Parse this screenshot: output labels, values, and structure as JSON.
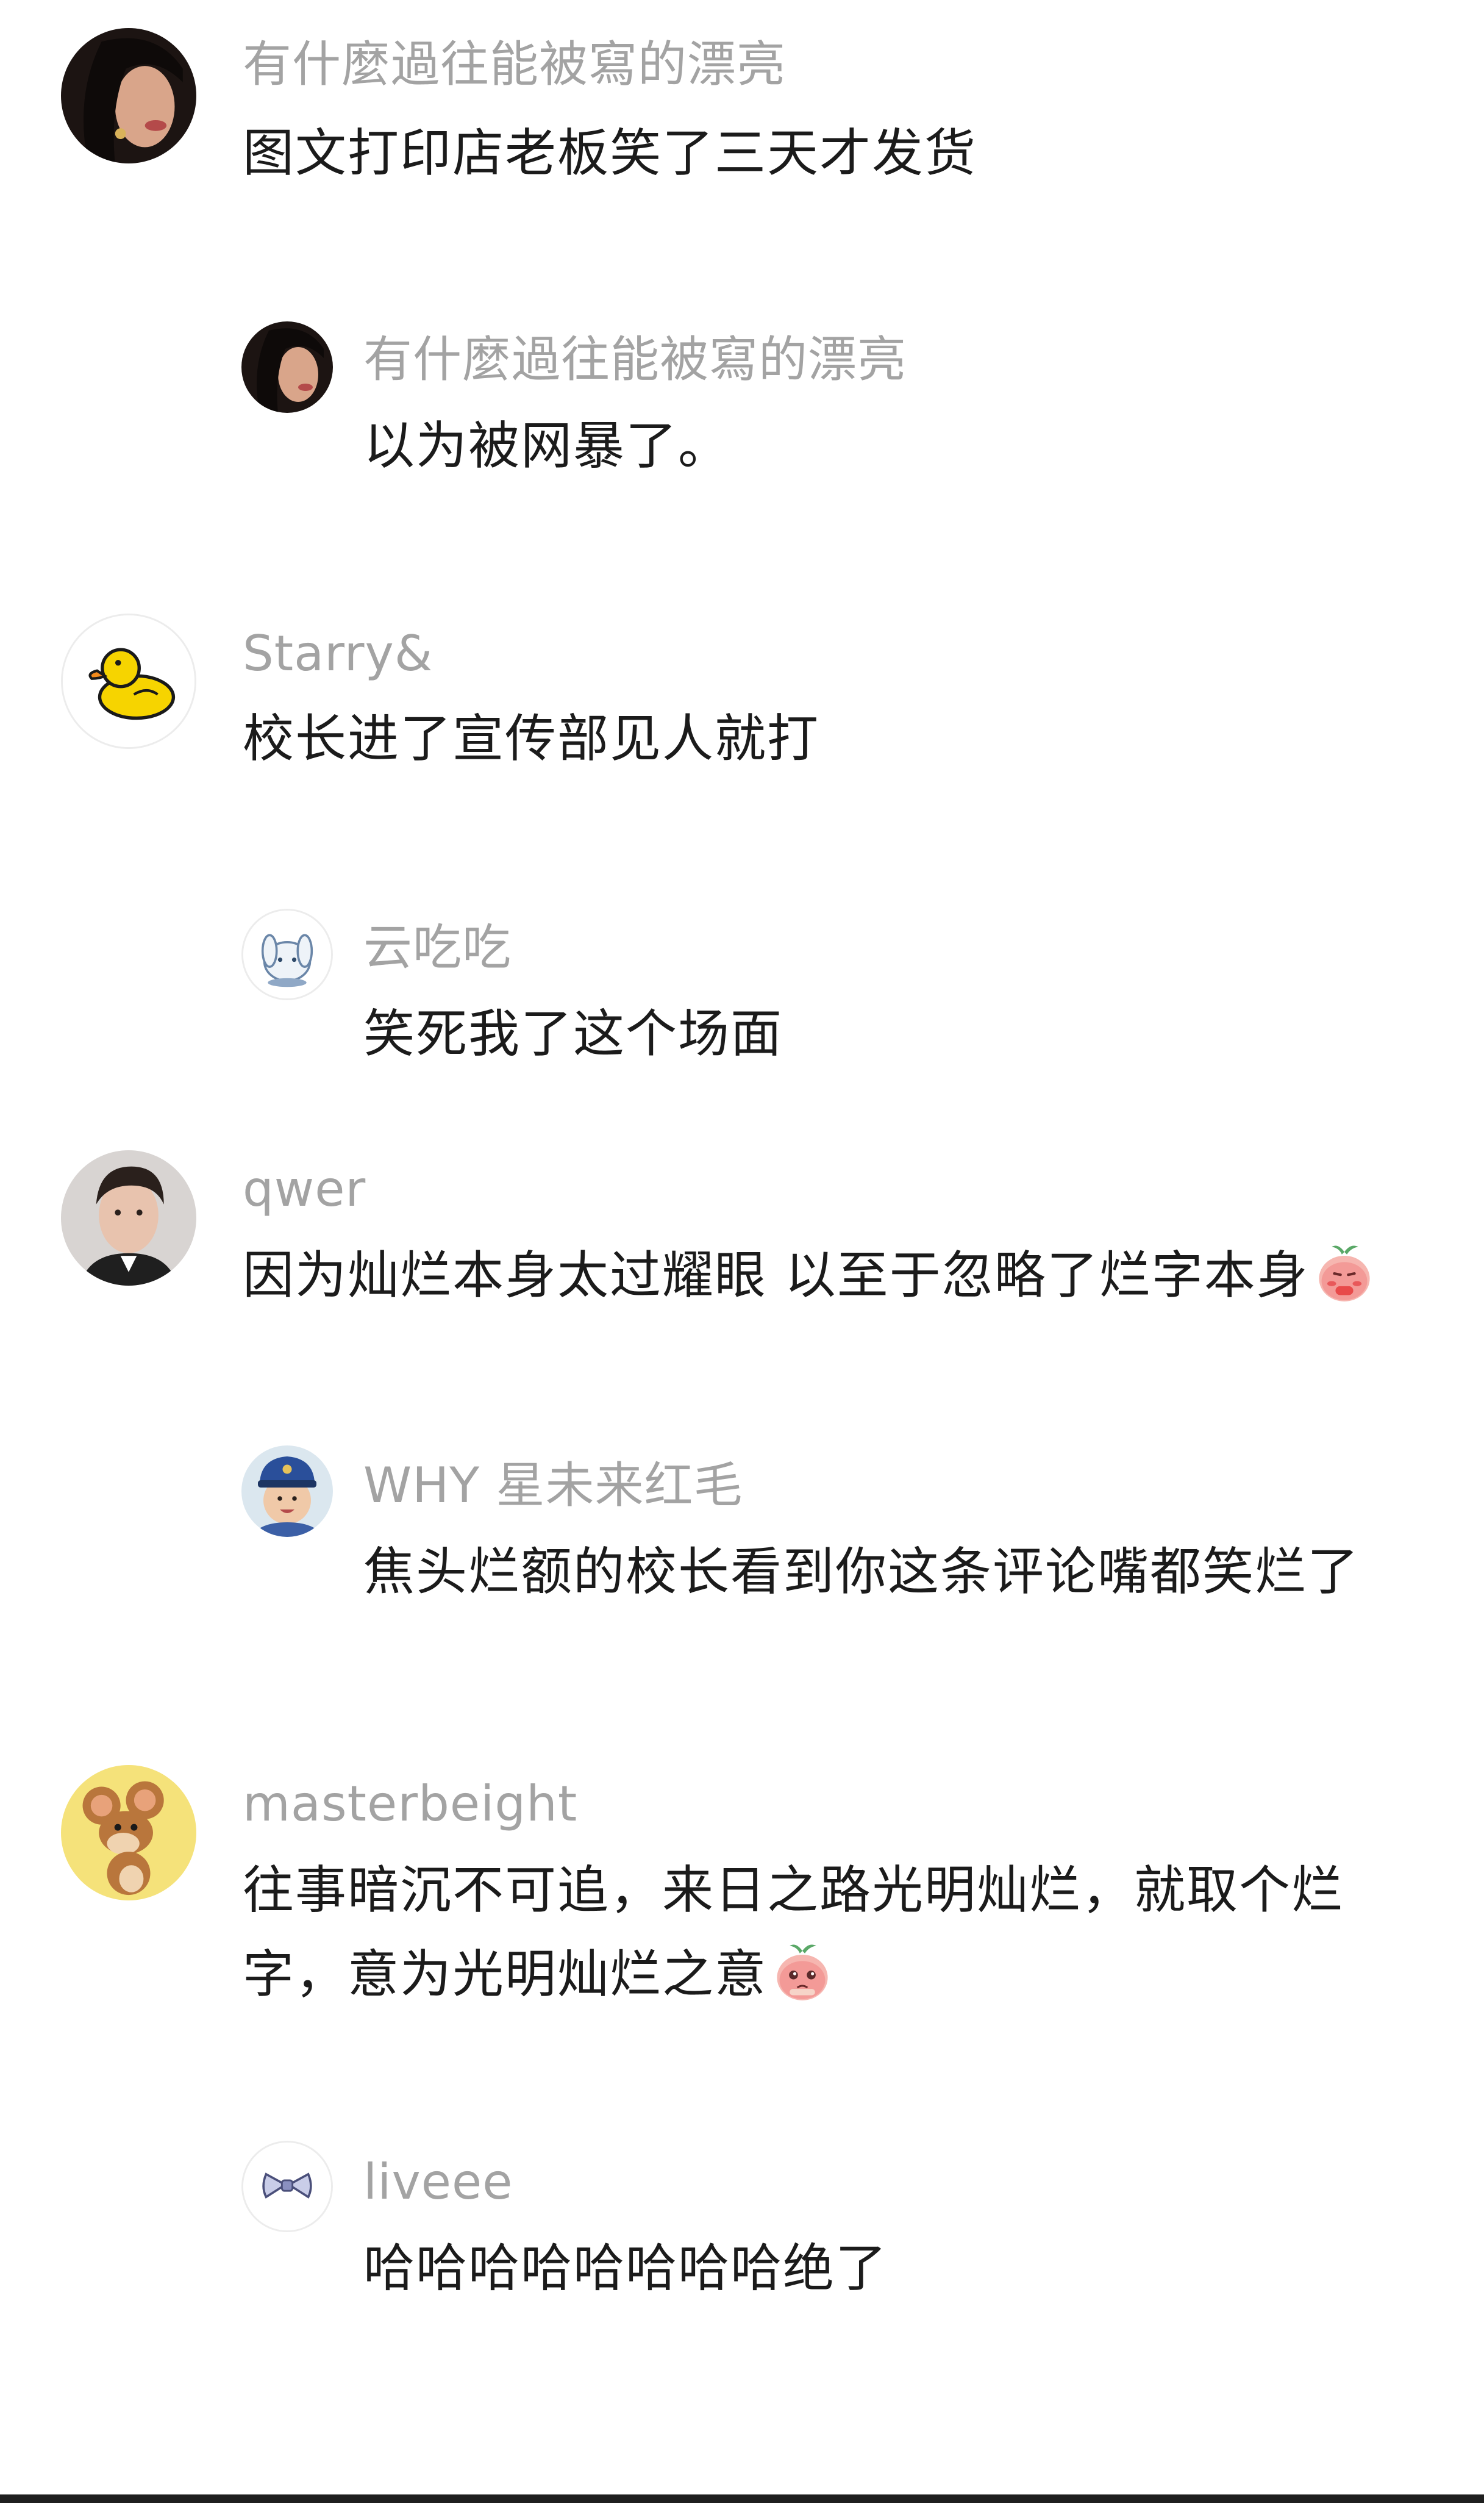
{
  "comments": [
    {
      "name": "有什麼過往能被寫的漂亮",
      "text": "图文打印店老板笑了三天才发货",
      "avatar": "woman-portrait-avatar"
    },
    {
      "name": "有什麼過往能被寫的漂亮",
      "text": "以为被网暴了。",
      "avatar": "woman-portrait-avatar"
    },
    {
      "name": "Starry&",
      "text": "校长进了宣传部见人就打",
      "avatar": "yellow-duck-avatar"
    },
    {
      "name": "云吃吃",
      "text": "笑死我了这个场面",
      "avatar": "white-bunny-avatar"
    },
    {
      "name": "qwer",
      "text": "因为灿烂本身太过耀眼 以至于忽略了烂字本身",
      "avatar": "man-portrait-avatar",
      "emoji": "shy-peach-emoji"
    },
    {
      "name": "WHY 星未来红毛",
      "text": "焦头烂额的校长看到你这条评论嘴都笑烂了",
      "avatar": "child-police-cap-avatar"
    },
    {
      "name": "masterbeight",
      "text_line1": "往事暗沉不可追，来日之路光明灿烂，就取个烂",
      "text_line2": "字，意为光明灿烂之意",
      "avatar": "cartoon-mouse-avatar",
      "emoji": "pleading-peach-emoji"
    },
    {
      "name": "liveee",
      "text": "哈哈哈哈哈哈哈哈绝了",
      "avatar": "bow-tie-avatar"
    }
  ]
}
